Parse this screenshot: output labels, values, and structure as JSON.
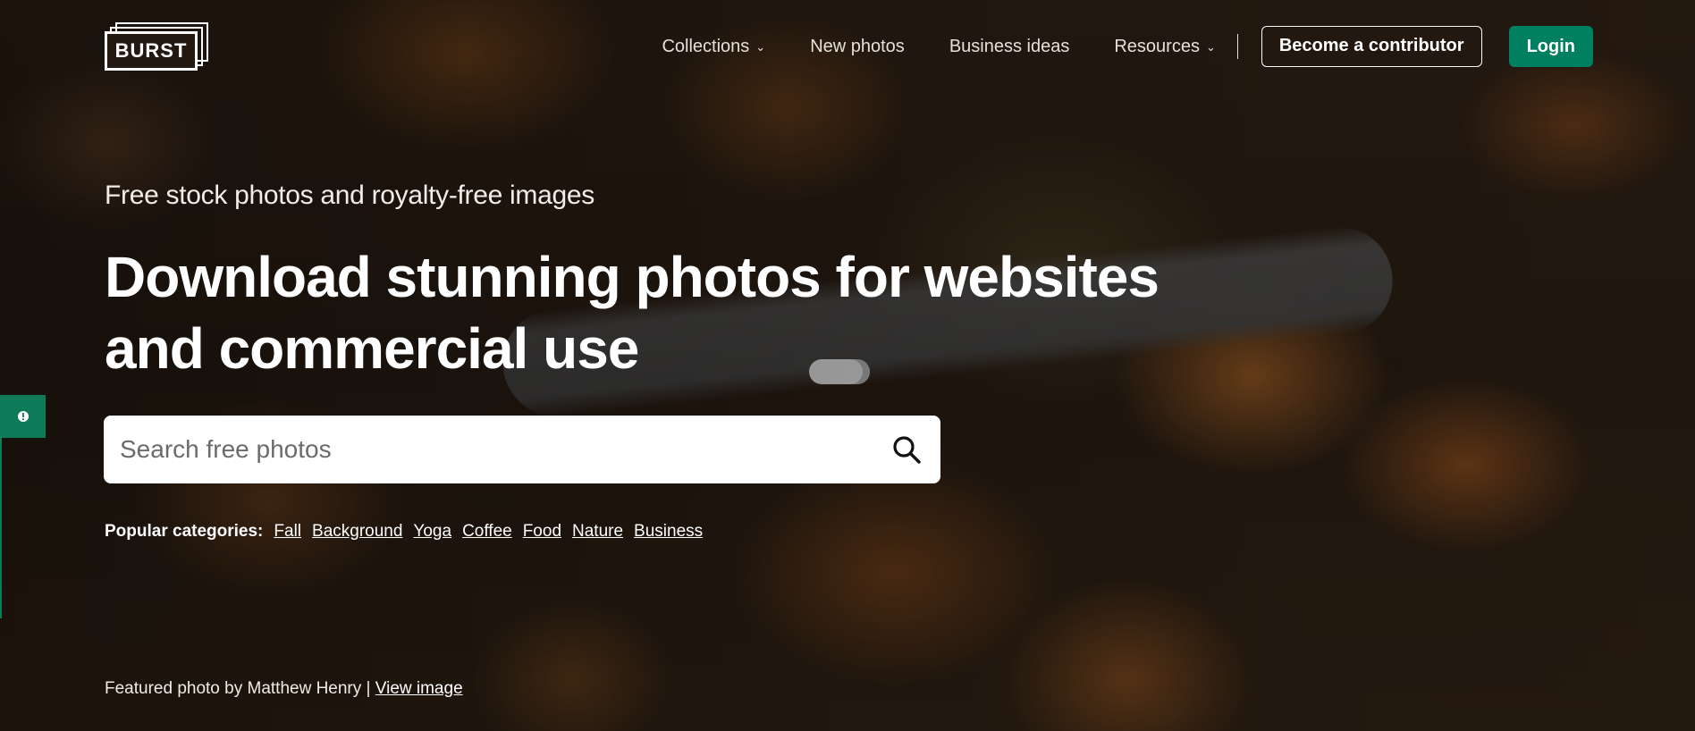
{
  "brand": {
    "logo_text": "BURST"
  },
  "nav": {
    "items": [
      {
        "label": "Collections",
        "has_dropdown": true
      },
      {
        "label": "New photos",
        "has_dropdown": false
      },
      {
        "label": "Business ideas",
        "has_dropdown": false
      },
      {
        "label": "Resources",
        "has_dropdown": true
      }
    ],
    "contributor_label": "Become a contributor",
    "login_label": "Login"
  },
  "hero": {
    "tagline": "Free stock photos and royalty-free images",
    "headline": "Download stunning photos for websites and commercial use"
  },
  "search": {
    "placeholder": "Search free photos",
    "icon": "search-icon"
  },
  "categories": {
    "label": "Popular categories:",
    "items": [
      "Fall",
      "Background",
      "Yoga",
      "Coffee",
      "Food",
      "Nature",
      "Business"
    ]
  },
  "credit": {
    "text": "Featured photo by Matthew Henry |",
    "link_label": "View image"
  },
  "feedback": {
    "icon": "feedback-icon"
  },
  "colors": {
    "accent": "#008060",
    "text": "#ffffff",
    "search_bg": "#ffffff"
  }
}
